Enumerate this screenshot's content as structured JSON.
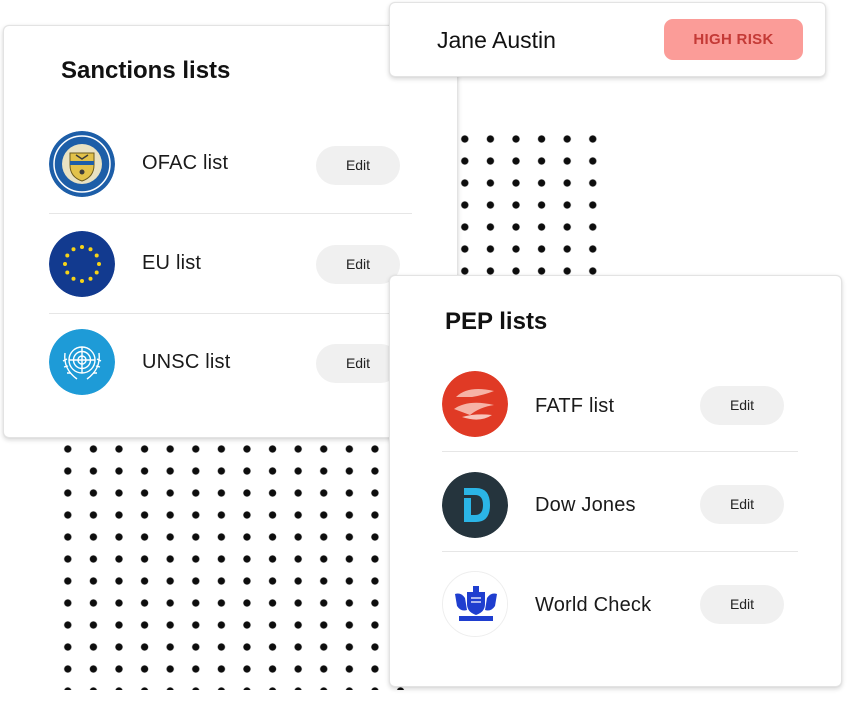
{
  "person": {
    "name": "Jane Austin",
    "risk_badge": "HIGH RISK",
    "risk_badge_bg": "#fb9c98",
    "risk_badge_text_color": "#c43a36"
  },
  "sanctions": {
    "title": "Sanctions lists",
    "items": [
      {
        "label": "OFAC list",
        "edit_label": "Edit",
        "icon": "treasury-seal-icon"
      },
      {
        "label": "EU list",
        "edit_label": "Edit",
        "icon": "eu-flag-icon"
      },
      {
        "label": "UNSC list",
        "edit_label": "Edit",
        "icon": "un-emblem-icon"
      }
    ]
  },
  "pep": {
    "title": "PEP lists",
    "items": [
      {
        "label": "FATF list",
        "edit_label": "Edit",
        "icon": "fatf-logo-icon"
      },
      {
        "label": "Dow Jones",
        "edit_label": "Edit",
        "icon": "dow-jones-logo-icon"
      },
      {
        "label": "World Check",
        "edit_label": "Edit",
        "icon": "world-check-crest-icon"
      }
    ]
  },
  "colors": {
    "edit_button_bg": "#f0f0f0",
    "eu_blue": "#123a8f",
    "un_blue": "#1e9bd7",
    "fatf_red": "#e03a25",
    "dow_jones_teal": "#2bb5e6"
  }
}
